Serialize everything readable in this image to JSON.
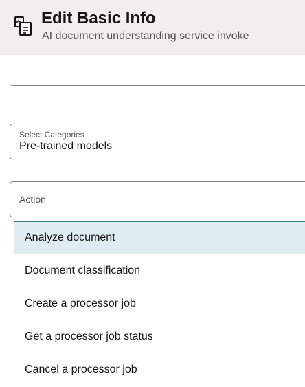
{
  "header": {
    "icon": "document-ai-icon",
    "title": "Edit Basic Info",
    "subtitle": "AI document understanding service invoke"
  },
  "categories": {
    "label": "Select Categories",
    "value": "Pre-trained models"
  },
  "action": {
    "label": "Action",
    "options": [
      {
        "label": "Analyze document",
        "selected": true
      },
      {
        "label": "Document classification",
        "selected": false
      },
      {
        "label": "Create a processor job",
        "selected": false
      },
      {
        "label": "Get a processor job status",
        "selected": false
      },
      {
        "label": "Cancel a processor job",
        "selected": false
      }
    ]
  },
  "colors": {
    "header_bg": "#f1efed",
    "selected_bg": "#dfecf2",
    "selected_border": "#3c7a8c"
  }
}
